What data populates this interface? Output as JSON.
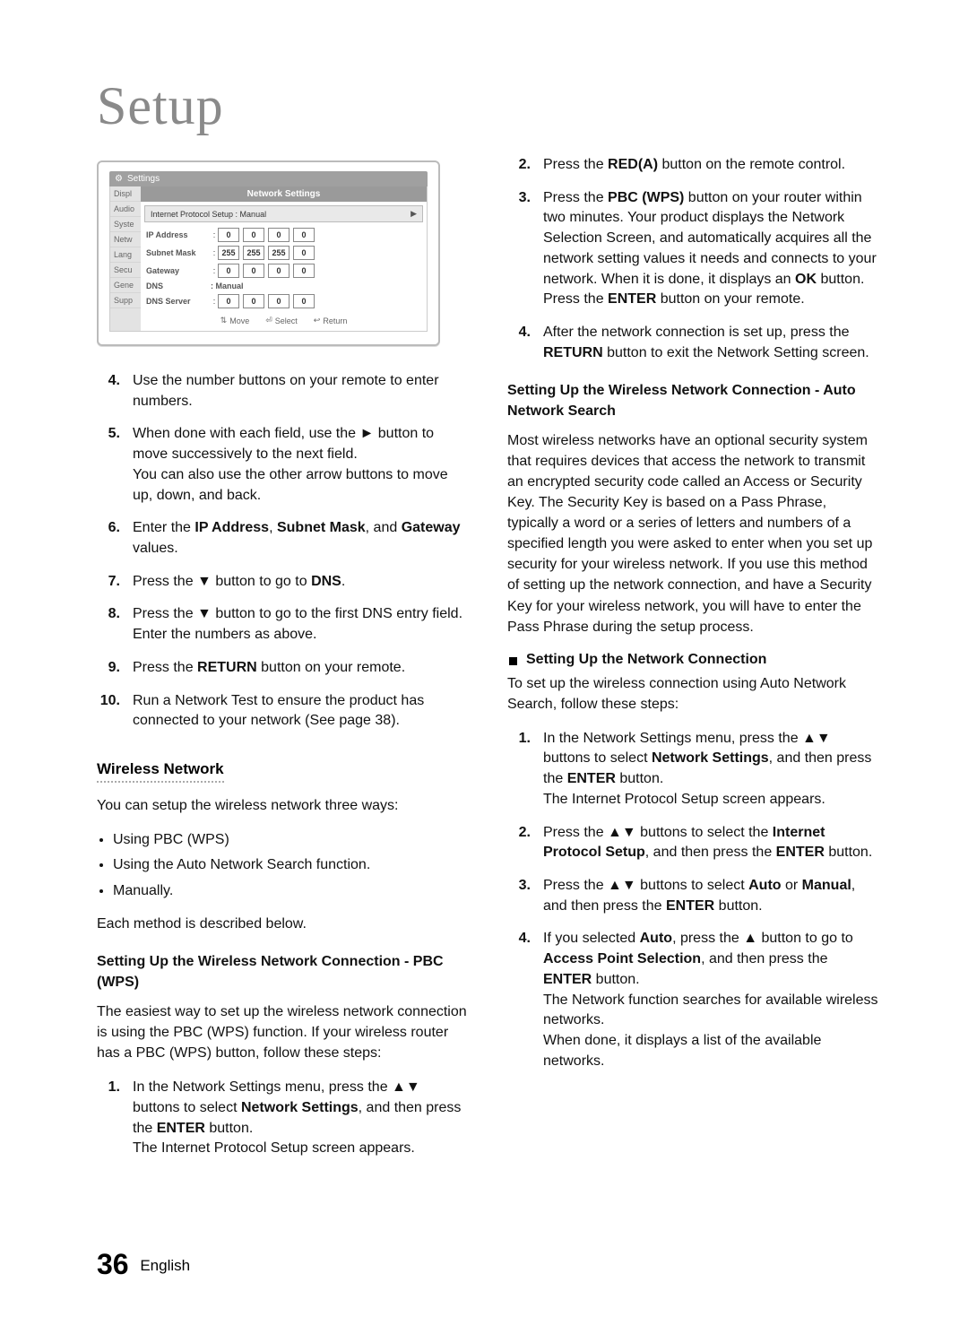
{
  "page": {
    "title": "Setup",
    "page_number": "36",
    "page_lang": "English"
  },
  "screenshot": {
    "settings_label": "Settings",
    "panel_title": "Network Settings",
    "header_row": "Internet Protocol Setup : Manual",
    "side_items": [
      "Displ",
      "Audio",
      "Syste",
      "Netw",
      "Lang",
      "Secu",
      "Gene",
      "Supp"
    ],
    "fields": [
      {
        "label": "IP Address",
        "cells": [
          "0",
          "0",
          "0",
          "0"
        ]
      },
      {
        "label": "Subnet Mask",
        "cells": [
          "255",
          "255",
          "255",
          "0"
        ]
      },
      {
        "label": "Gateway",
        "cells": [
          "0",
          "0",
          "0",
          "0"
        ]
      }
    ],
    "dns_label": "DNS",
    "dns_value": ": Manual",
    "dns_server": {
      "label": "DNS Server",
      "cells": [
        "0",
        "0",
        "0",
        "0"
      ]
    },
    "footer": {
      "move": "Move",
      "select": "Select",
      "return": "Return"
    }
  },
  "left": {
    "steps": [
      {
        "n": "4.",
        "t": "Use the number buttons on your remote to enter numbers."
      },
      {
        "n": "5.",
        "t_parts": [
          "When done with each field, use the ► button to move successively to the next field.",
          "You can also use the other arrow buttons to move up, down, and back."
        ]
      },
      {
        "n": "6.",
        "pre": "Enter the ",
        "b1": "IP Address",
        "mid1": ", ",
        "b2": "Subnet Mask",
        "mid2": ", and ",
        "b3": "Gateway",
        "post": " values."
      },
      {
        "n": "7.",
        "pre": "Press the ▼ button to go to ",
        "b1": "DNS",
        "post": "."
      },
      {
        "n": "8.",
        "t": "Press the ▼ button to go to the first DNS entry field. Enter the numbers as above."
      },
      {
        "n": "9.",
        "pre": "Press the ",
        "b1": "RETURN",
        "post": " button on your remote."
      },
      {
        "n": "10.",
        "t": "Run a Network Test to ensure the product has connected to your network (See page 38)."
      }
    ],
    "wireless_heading": "Wireless Network",
    "wireless_intro": "You can setup the wireless network three ways:",
    "wireless_bullets": [
      "Using PBC (WPS)",
      "Using the Auto Network Search function.",
      "Manually."
    ],
    "wireless_after": "Each method is described below.",
    "pbc_heading": "Setting Up the Wireless Network Connection - PBC (WPS)",
    "pbc_intro": "The easiest way to set up the wireless network connection is using the PBC (WPS) function. If your wireless router has a PBC (WPS) button, follow these steps:",
    "pbc_steps": [
      {
        "n": "1.",
        "pre": "In the Network Settings menu, press the ▲▼ buttons to select ",
        "b1": "Network Settings",
        "mid": ", and then press the ",
        "b2": "ENTER",
        "post": " button.",
        "tail": "The Internet Protocol Setup screen appears."
      }
    ]
  },
  "right": {
    "cont_steps": [
      {
        "n": "2.",
        "pre": "Press the ",
        "b1": "RED(A)",
        "post": " button on the remote control."
      },
      {
        "n": "3.",
        "pre": "Press the ",
        "b1": "PBC (WPS)",
        "mid": " button on your router within two minutes. Your product displays the Network Selection Screen, and automatically acquires all the network setting values it needs and connects to your network. When it is done, it displays an ",
        "b2": "OK",
        "mid2": " button. Press the ",
        "b3": "ENTER",
        "post": " button on your remote."
      },
      {
        "n": "4.",
        "pre": "After the network connection is set up, press the ",
        "b1": "RETURN",
        "post": " button to exit the Network Setting screen."
      }
    ],
    "auto_heading": "Setting Up the Wireless Network Connection - Auto Network Search",
    "auto_para": "Most wireless networks have an optional security system that requires devices that access the network to transmit an encrypted security code called an Access or Security Key. The Security Key is based on a Pass Phrase, typically a word or a series of letters and numbers of a specified length you were asked to enter when you set up security for your wireless network. If you use this method of setting up the network connection, and have a Security Key for your wireless network, you will have to enter the Pass Phrase during the setup process.",
    "square_item": "Setting Up the Network Connection",
    "auto_intro": "To set up the wireless connection using Auto Network Search, follow these steps:",
    "auto_steps": [
      {
        "n": "1.",
        "pre": "In the Network Settings menu, press the ▲▼ buttons to select ",
        "b1": "Network Settings",
        "mid": ", and then press the ",
        "b2": "ENTER",
        "post": " button.",
        "tail": "The Internet Protocol Setup screen appears."
      },
      {
        "n": "2.",
        "pre": "Press the ▲▼ buttons to select the ",
        "b1": "Internet Protocol Setup",
        "mid": ", and then press the ",
        "b2": "ENTER",
        "post": " button."
      },
      {
        "n": "3.",
        "pre": "Press the ▲▼ buttons to select ",
        "b1": "Auto",
        "mid": " or ",
        "b2": "Manual",
        "mid2": ", and then press the ",
        "b3": "ENTER",
        "post": " button."
      },
      {
        "n": "4.",
        "pre": "If you selected ",
        "b1": "Auto",
        "mid": ", press the ▲ button to go to ",
        "b2": "Access Point Selection",
        "mid2": ", and then press the ",
        "b3": "ENTER",
        "post": " button.",
        "tail": "The Network function searches for available wireless networks.",
        "tail2": "When done, it displays a list of the available networks."
      }
    ]
  }
}
